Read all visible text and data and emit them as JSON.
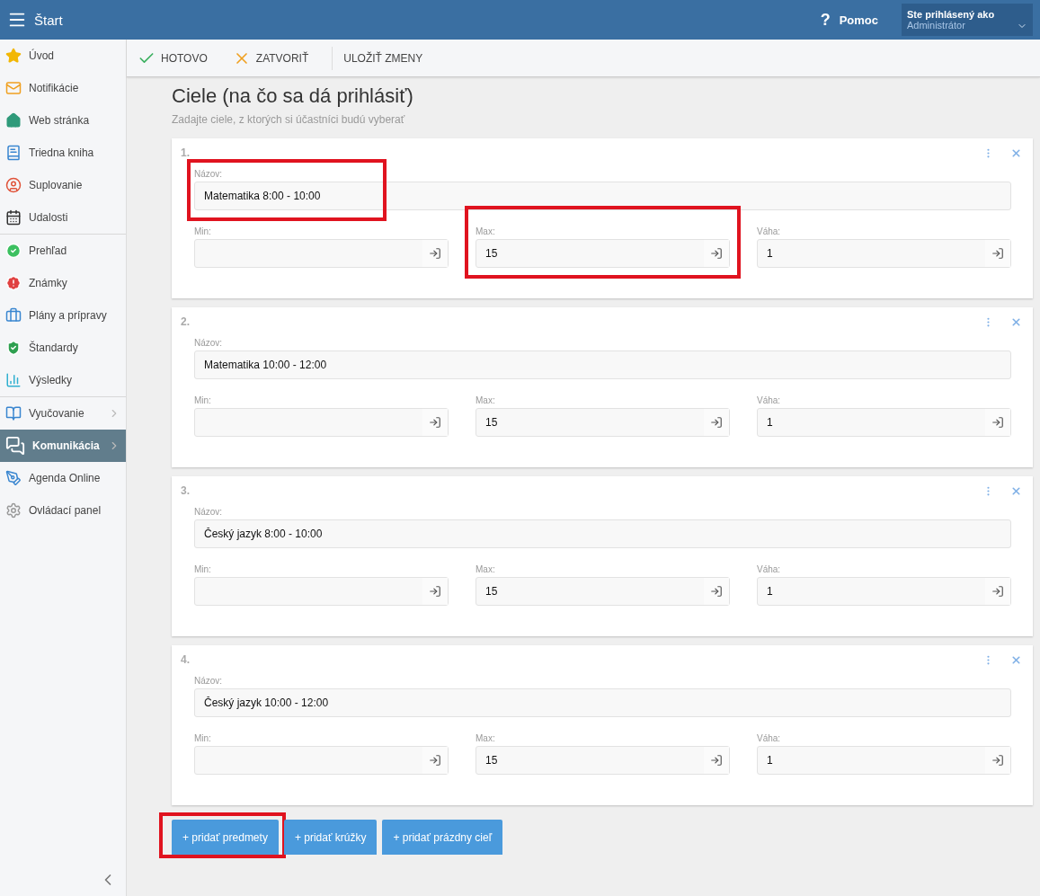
{
  "header": {
    "title": "Štart",
    "help": {
      "icon": "?",
      "label": "Pomoc"
    },
    "user": {
      "caption": "Ste prihlásený ako",
      "name": "Administrátor"
    }
  },
  "sidebar": {
    "groups": [
      [
        {
          "kind": "star",
          "label": "Úvod",
          "expandable": false,
          "selected": false
        },
        {
          "kind": "mail",
          "label": "Notifikácie",
          "expandable": false,
          "selected": false
        },
        {
          "kind": "home",
          "label": "Web stránka",
          "expandable": false,
          "selected": false
        },
        {
          "kind": "book",
          "label": "Triedna kniha",
          "expandable": false,
          "selected": false
        },
        {
          "kind": "person",
          "label": "Suplovanie",
          "expandable": false,
          "selected": false
        },
        {
          "kind": "calendar",
          "label": "Udalosti",
          "expandable": false,
          "selected": false
        }
      ],
      [
        {
          "kind": "check",
          "label": "Prehľad",
          "expandable": false,
          "selected": false
        },
        {
          "kind": "grade",
          "label": "Známky",
          "expandable": false,
          "selected": false
        },
        {
          "kind": "briefcase",
          "label": "Plány a prípravy",
          "expandable": false,
          "selected": false
        },
        {
          "kind": "shield",
          "label": "Štandardy",
          "expandable": false,
          "selected": false
        },
        {
          "kind": "chart",
          "label": "Výsledky",
          "expandable": false,
          "selected": false
        }
      ],
      [
        {
          "kind": "openbook",
          "label": "Vyučovanie",
          "expandable": true,
          "selected": false
        },
        {
          "kind": "chat",
          "label": "Komunikácia",
          "expandable": true,
          "selected": true
        },
        {
          "kind": "pen",
          "label": "Agenda Online",
          "expandable": false,
          "selected": false
        },
        {
          "kind": "gear",
          "label": "Ovládací panel",
          "expandable": false,
          "selected": false
        }
      ]
    ]
  },
  "toolbar": [
    {
      "kind": "done",
      "label": "HOTOVO"
    },
    {
      "kind": "close",
      "label": "ZATVORIŤ"
    },
    {
      "kind": "save",
      "label": "ULOŽIŤ ZMENY"
    }
  ],
  "page": {
    "title": "Ciele (na čo sa dá prihlásiť)",
    "subtitle": "Zadajte ciele, z ktorých si účastníci budú vyberať"
  },
  "targets": [
    {
      "number": "1.",
      "name": {
        "label": "Názov:",
        "value": "Matematika 8:00 - 10:00",
        "highlighted": true
      },
      "fields": [
        {
          "label": "Min:",
          "highlighted": false
        },
        {
          "label": "Max:",
          "value": "15",
          "highlighted": true
        },
        {
          "label": "Váha:",
          "value": "1",
          "highlighted": false
        }
      ]
    },
    {
      "number": "2.",
      "name": {
        "label": "Názov:",
        "value": "Matematika 10:00 - 12:00",
        "highlighted": false
      },
      "fields": [
        {
          "label": "Min:",
          "highlighted": false
        },
        {
          "label": "Max:",
          "value": "15",
          "highlighted": false
        },
        {
          "label": "Váha:",
          "value": "1",
          "highlighted": false
        }
      ]
    },
    {
      "number": "3.",
      "name": {
        "label": "Názov:",
        "value": "Český jazyk 8:00 - 10:00",
        "highlighted": false
      },
      "fields": [
        {
          "label": "Min:",
          "highlighted": false
        },
        {
          "label": "Max:",
          "value": "15",
          "highlighted": false
        },
        {
          "label": "Váha:",
          "value": "1",
          "highlighted": false
        }
      ]
    },
    {
      "number": "4.",
      "name": {
        "label": "Názov:",
        "value": "Český jazyk 10:00 - 12:00",
        "highlighted": false
      },
      "fields": [
        {
          "label": "Min:",
          "highlighted": false
        },
        {
          "label": "Max:",
          "value": "15",
          "highlighted": false
        },
        {
          "label": "Váha:",
          "value": "1",
          "highlighted": false
        }
      ]
    }
  ],
  "actions": [
    {
      "label": "+ pridať predmety",
      "highlighted": true
    },
    {
      "label": "+ pridať krúžky",
      "highlighted": false
    },
    {
      "label": "+ pridať prázdny cieľ",
      "highlighted": false
    }
  ]
}
